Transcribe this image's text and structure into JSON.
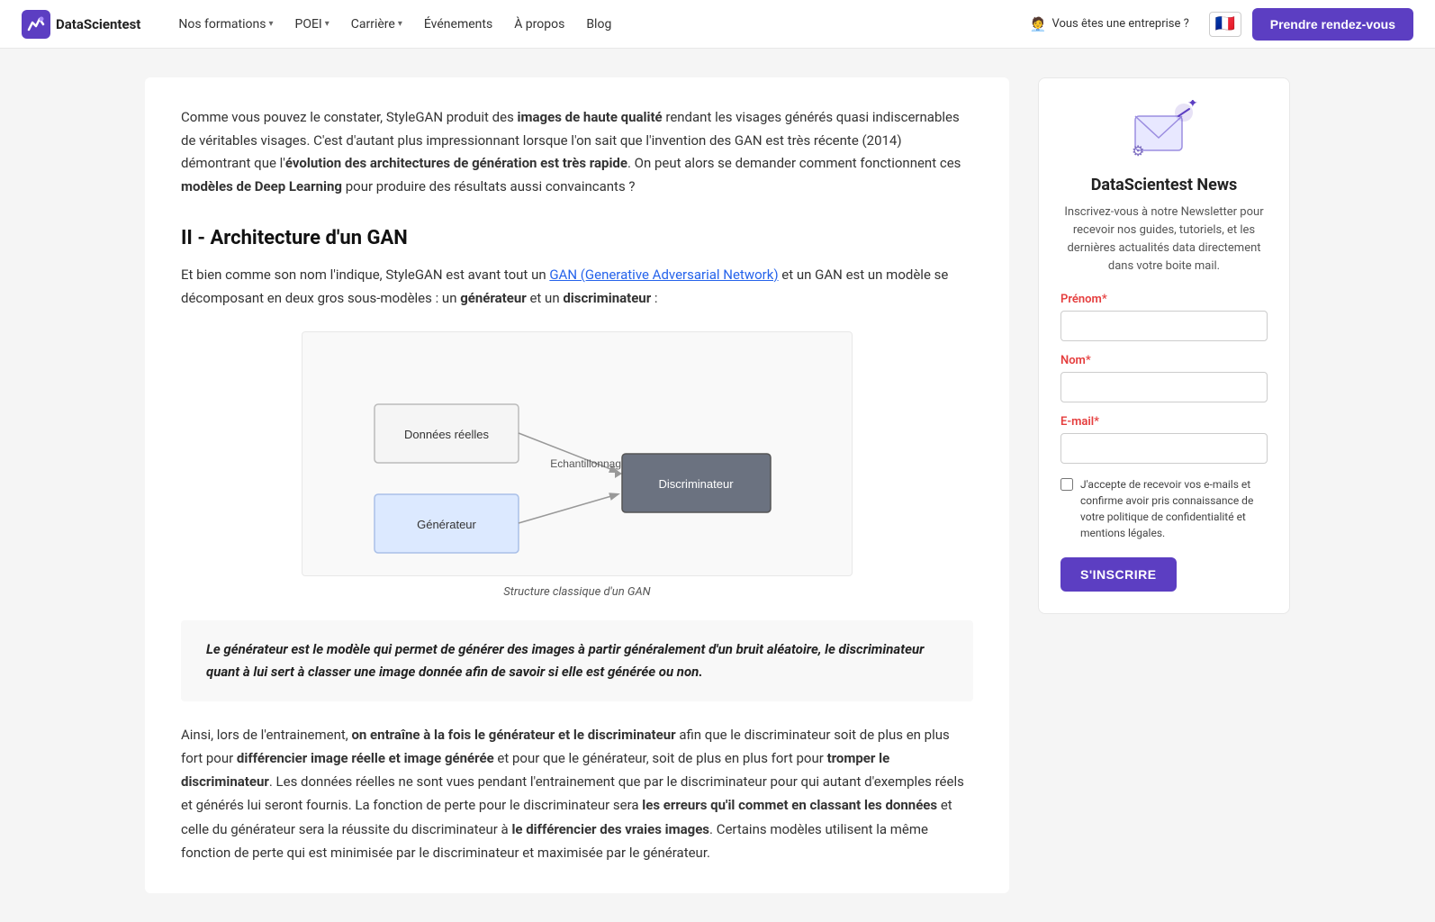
{
  "header": {
    "logo_text": "DataScientest",
    "nav_items": [
      {
        "label": "Nos formations",
        "has_dropdown": true
      },
      {
        "label": "POEI",
        "has_dropdown": true
      },
      {
        "label": "Carrière",
        "has_dropdown": true
      },
      {
        "label": "Événements",
        "has_dropdown": false
      },
      {
        "label": "À propos",
        "has_dropdown": false
      },
      {
        "label": "Blog",
        "has_dropdown": false
      }
    ],
    "enterprise_label": "Vous êtes une entreprise ?",
    "flag_emoji": "🇫🇷",
    "cta_label": "Prendre rendez-vous"
  },
  "main": {
    "intro_paragraph": "Comme vous pouvez le constater, StyleGAN produit des ",
    "intro_bold1": "images de haute qualité",
    "intro_mid1": " rendant les visages générés quasi indiscernables de véritables visages. C'est d'autant plus impressionnant lorsque l'on sait que l'invention des GAN est très récente (2014) démontrant que l'",
    "intro_bold2": "évolution des architectures de génération est très rapide",
    "intro_end": ". On peut alors se demander comment fonctionnent ces ",
    "intro_bold3": "modèles de Deep Learning",
    "intro_final": " pour produire des résultats aussi convaincants ?",
    "section_heading": "II - Architecture d'un GAN",
    "section_intro_before": "Et bien comme son nom l'indique, StyleGAN est avant tout un ",
    "section_link_text": "GAN (Generative Adversarial Network)",
    "section_intro_after": " et un GAN est un modèle se décomposant en deux gros sous-modèles : un ",
    "generateur": "générateur",
    "et_un": " et un ",
    "discriminateur": "discriminateur",
    "colon": " :",
    "diagram_caption": "Structure classique d'un GAN",
    "diagram_nodes": {
      "donnees": "Données réelles",
      "echantillonnage": "Echantillonnage",
      "discriminateur": "Discriminateur",
      "generateur": "Générateur"
    },
    "quote_text": "Le générateur est le modèle qui permet de générer des images à partir généralement d'un bruit aléatoire, le discriminateur quant à lui sert à classer une image donnée afin de savoir si elle est générée ou non.",
    "body_para_before1": "Ainsi, lors de l'entrainement, ",
    "body_bold1": "on entraîne à la fois le générateur et le discriminateur",
    "body_mid1": " afin que le discriminateur soit de plus en plus fort pour ",
    "body_bold2": "différencier image réelle et image générée",
    "body_mid2": " et pour que le générateur, soit de plus en plus fort pour ",
    "body_bold3": "tromper le discriminateur",
    "body_mid3": ". Les données réelles ne sont vues pendant l'entrainement que par le discriminateur pour qui autant d'exemples réels et générés lui seront fournis. La fonction de perte pour le discriminateur sera ",
    "body_bold4": "les erreurs qu'il commet en classant les données",
    "body_mid4": " et celle du générateur sera la réussite du discriminateur à ",
    "body_bold5": "le différencier des vraies images",
    "body_end": ". Certains modèles utilisent la même fonction de perte qui est minimisée par le discriminateur et maximisée par le générateur."
  },
  "sidebar": {
    "news_title": "DataScientest News",
    "news_description": "Inscrivez-vous à notre Newsletter pour recevoir nos guides, tutoriels, et les dernières actualités data directement dans votre boite mail.",
    "prenom_label": "Prénom",
    "nom_label": "Nom",
    "email_label": "E-mail",
    "required_star": "*",
    "checkbox_text": "J'accepte de recevoir vos e-mails et confirme avoir pris connaissance de votre politique de confidentialité et mentions légales.",
    "submit_label": "S'INSCRIRE",
    "prenom_value": "",
    "nom_value": "",
    "email_value": ""
  },
  "colors": {
    "accent": "#5c3ec2",
    "link": "#2563eb",
    "text": "#333",
    "heading": "#111"
  }
}
